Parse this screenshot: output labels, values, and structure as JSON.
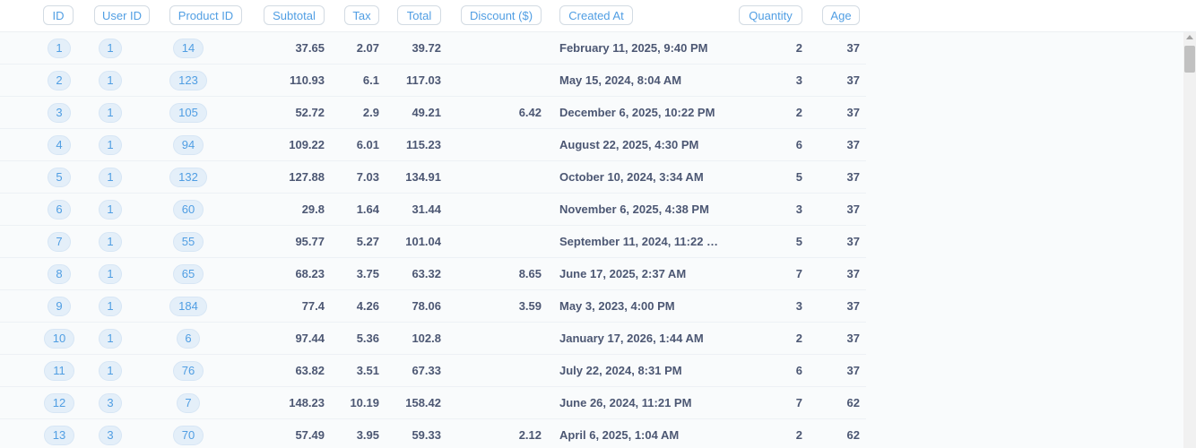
{
  "columns": [
    {
      "label": "ID"
    },
    {
      "label": "User ID"
    },
    {
      "label": "Product ID"
    },
    {
      "label": "Subtotal"
    },
    {
      "label": "Tax"
    },
    {
      "label": "Total"
    },
    {
      "label": "Discount ($)"
    },
    {
      "label": "Created At"
    },
    {
      "label": "Quantity"
    },
    {
      "label": "Age"
    }
  ],
  "rows": [
    {
      "id": "1",
      "user_id": "1",
      "product_id": "14",
      "subtotal": "37.65",
      "tax": "2.07",
      "total": "39.72",
      "discount": "",
      "created_at": "February 11, 2025, 9:40 PM",
      "quantity": "2",
      "age": "37"
    },
    {
      "id": "2",
      "user_id": "1",
      "product_id": "123",
      "subtotal": "110.93",
      "tax": "6.1",
      "total": "117.03",
      "discount": "",
      "created_at": "May 15, 2024, 8:04 AM",
      "quantity": "3",
      "age": "37"
    },
    {
      "id": "3",
      "user_id": "1",
      "product_id": "105",
      "subtotal": "52.72",
      "tax": "2.9",
      "total": "49.21",
      "discount": "6.42",
      "created_at": "December 6, 2025, 10:22 PM",
      "quantity": "2",
      "age": "37"
    },
    {
      "id": "4",
      "user_id": "1",
      "product_id": "94",
      "subtotal": "109.22",
      "tax": "6.01",
      "total": "115.23",
      "discount": "",
      "created_at": "August 22, 2025, 4:30 PM",
      "quantity": "6",
      "age": "37"
    },
    {
      "id": "5",
      "user_id": "1",
      "product_id": "132",
      "subtotal": "127.88",
      "tax": "7.03",
      "total": "134.91",
      "discount": "",
      "created_at": "October 10, 2024, 3:34 AM",
      "quantity": "5",
      "age": "37"
    },
    {
      "id": "6",
      "user_id": "1",
      "product_id": "60",
      "subtotal": "29.8",
      "tax": "1.64",
      "total": "31.44",
      "discount": "",
      "created_at": "November 6, 2025, 4:38 PM",
      "quantity": "3",
      "age": "37"
    },
    {
      "id": "7",
      "user_id": "1",
      "product_id": "55",
      "subtotal": "95.77",
      "tax": "5.27",
      "total": "101.04",
      "discount": "",
      "created_at": "September 11, 2024, 11:22 …",
      "quantity": "5",
      "age": "37"
    },
    {
      "id": "8",
      "user_id": "1",
      "product_id": "65",
      "subtotal": "68.23",
      "tax": "3.75",
      "total": "63.32",
      "discount": "8.65",
      "created_at": "June 17, 2025, 2:37 AM",
      "quantity": "7",
      "age": "37"
    },
    {
      "id": "9",
      "user_id": "1",
      "product_id": "184",
      "subtotal": "77.4",
      "tax": "4.26",
      "total": "78.06",
      "discount": "3.59",
      "created_at": "May 3, 2023, 4:00 PM",
      "quantity": "3",
      "age": "37"
    },
    {
      "id": "10",
      "user_id": "1",
      "product_id": "6",
      "subtotal": "97.44",
      "tax": "5.36",
      "total": "102.8",
      "discount": "",
      "created_at": "January 17, 2026, 1:44 AM",
      "quantity": "2",
      "age": "37"
    },
    {
      "id": "11",
      "user_id": "1",
      "product_id": "76",
      "subtotal": "63.82",
      "tax": "3.51",
      "total": "67.33",
      "discount": "",
      "created_at": "July 22, 2024, 8:31 PM",
      "quantity": "6",
      "age": "37"
    },
    {
      "id": "12",
      "user_id": "3",
      "product_id": "7",
      "subtotal": "148.23",
      "tax": "10.19",
      "total": "158.42",
      "discount": "",
      "created_at": "June 26, 2024, 11:21 PM",
      "quantity": "7",
      "age": "62"
    },
    {
      "id": "13",
      "user_id": "3",
      "product_id": "70",
      "subtotal": "57.49",
      "tax": "3.95",
      "total": "59.33",
      "discount": "2.12",
      "created_at": "April 6, 2025, 1:04 AM",
      "quantity": "2",
      "age": "62"
    }
  ]
}
